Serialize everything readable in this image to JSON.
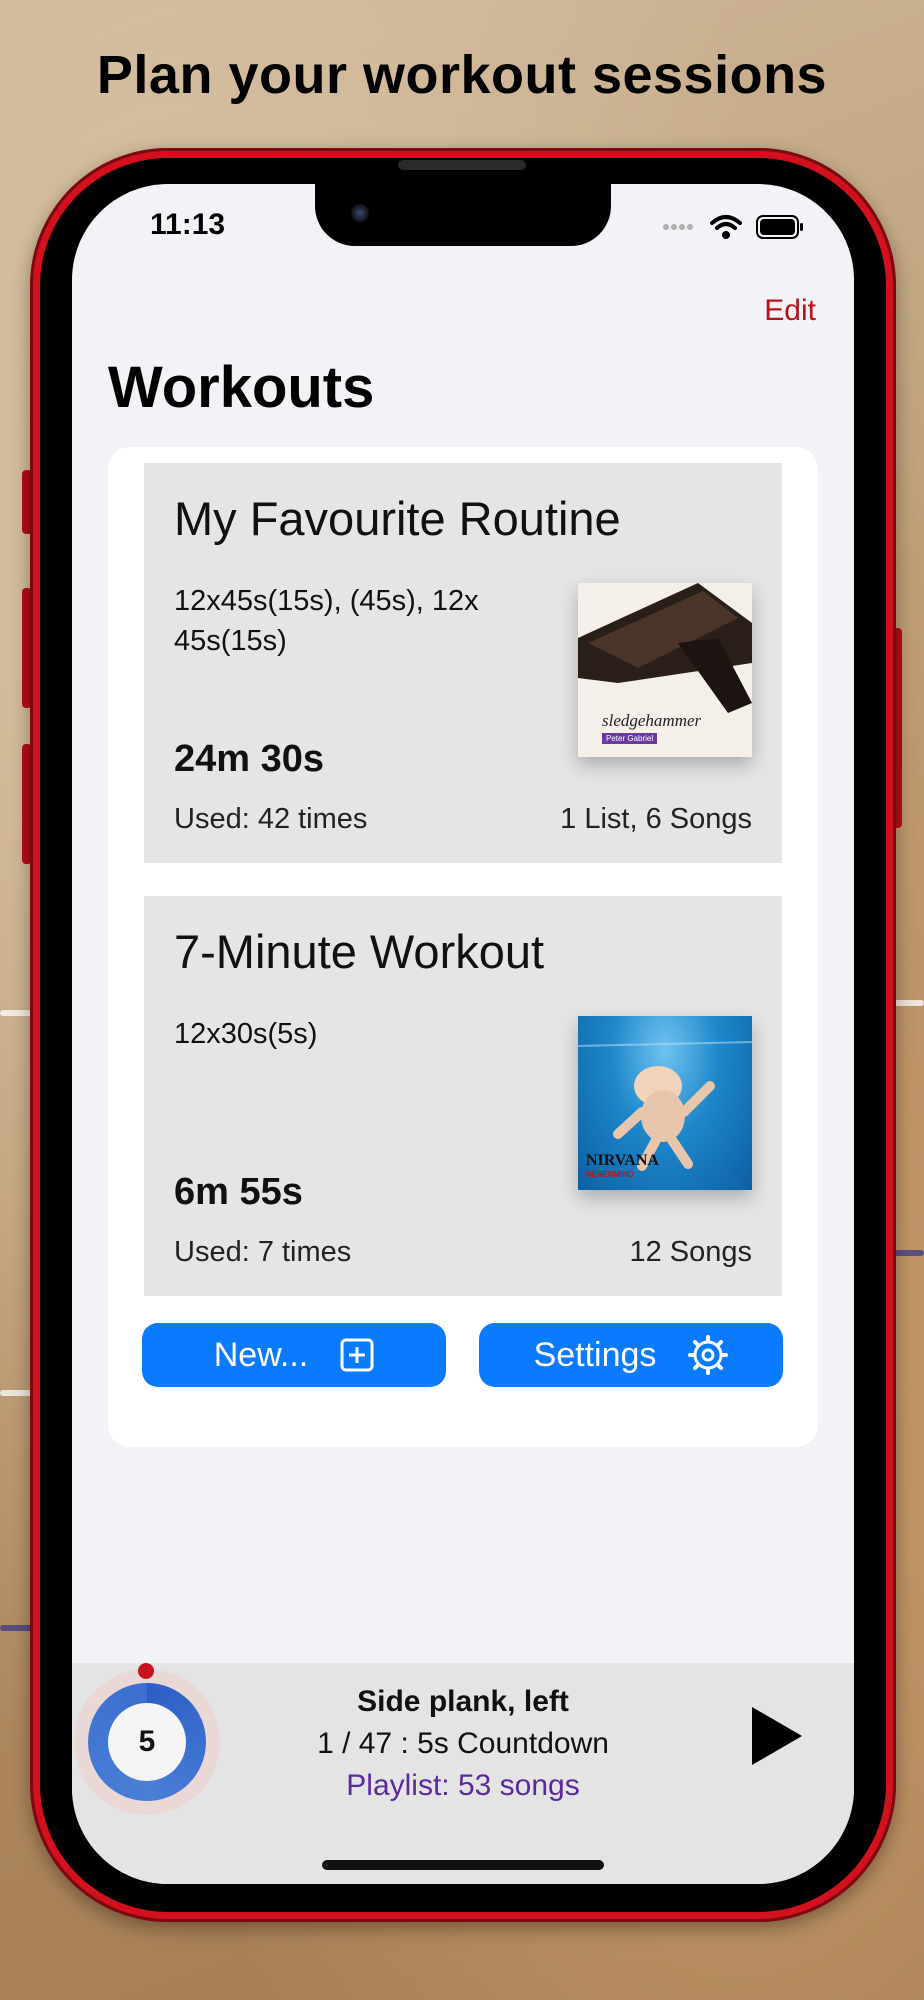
{
  "headline": "Plan your workout sessions",
  "status": {
    "time": "11:13"
  },
  "nav": {
    "edit_label": "Edit",
    "title": "Workouts"
  },
  "workouts": [
    {
      "title": "My Favourite Routine",
      "description": "12x45s(15s), (45s), 12x 45s(15s)",
      "duration": "24m 30s",
      "used": "Used: 42 times",
      "music": "1 List, 6 Songs",
      "album_text": "sledgehammer",
      "album_badge": "Peter Gabriel"
    },
    {
      "title": "7-Minute Workout",
      "description": "12x30s(5s)",
      "duration": "6m 55s",
      "used": "Used: 7 times",
      "music": "12 Songs",
      "album_text": "NIRVANA",
      "album_badge": "NEVERMIND"
    }
  ],
  "actions": {
    "new_label": "New...",
    "settings_label": "Settings"
  },
  "player": {
    "countdown": "5",
    "exercise": "Side plank, left",
    "progress": "1 / 47 : 5s Countdown",
    "playlist": "Playlist: 53 songs"
  },
  "colors": {
    "accent": "#0a7aff",
    "edit": "#b5141f",
    "phone": "#d3101d",
    "playlist": "#5a2a9a"
  }
}
